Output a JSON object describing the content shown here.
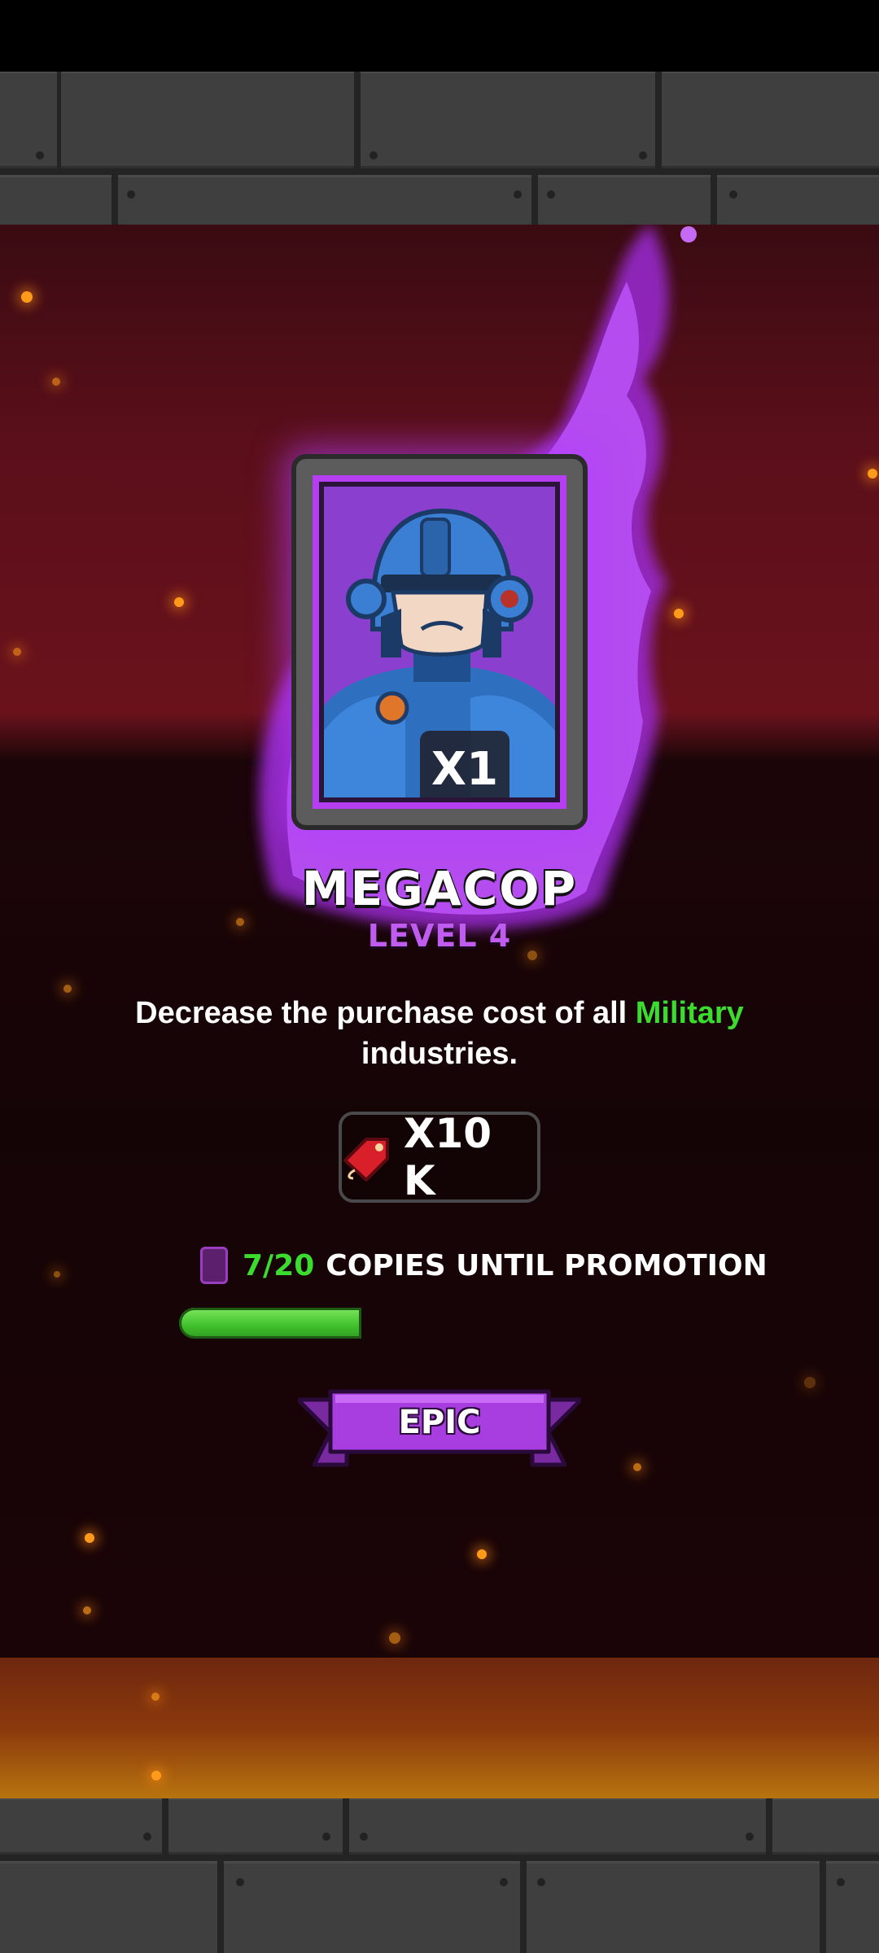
{
  "hero": {
    "name": "MEGACOP",
    "level": "LEVEL 4",
    "count": "X1",
    "rarity": "EPIC",
    "description_prefix": "Decrease the purchase cost of all ",
    "description_highlight": "Military",
    "description_suffix": " industries."
  },
  "cost": {
    "icon": "price-tag-icon",
    "value": "X10 K"
  },
  "promotion": {
    "icon": "card-copy-icon",
    "count": "7/20",
    "label": "COPIES UNTIL PROMOTION",
    "progress": 0.35
  },
  "colors": {
    "rarity": "#b53ff0",
    "highlight": "#3bdc2e",
    "background": "#6a121c"
  }
}
